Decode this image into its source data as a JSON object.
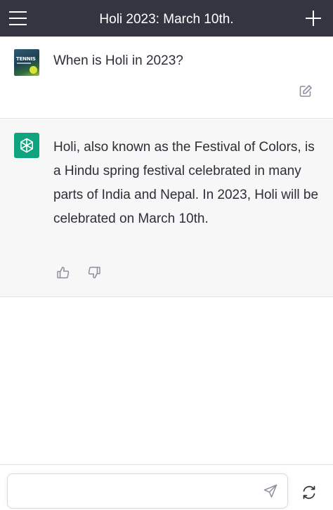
{
  "header": {
    "title": "Holi 2023: March 10th.",
    "menu_icon": "hamburger-menu-icon",
    "new_chat_icon": "plus-icon"
  },
  "conversation": {
    "user_message": {
      "avatar_label": "TENNIS",
      "text": "When is Holi in 2023?",
      "edit_icon": "edit-icon"
    },
    "assistant_message": {
      "avatar_icon": "openai-logo-icon",
      "text": "Holi, also known as the Festival of Colors, is a Hindu spring festival celebrated in many parts of India and Nepal. In 2023, Holi will be celebrated on March 10th.",
      "thumbs_up_icon": "thumbs-up-icon",
      "thumbs_down_icon": "thumbs-down-icon"
    }
  },
  "composer": {
    "value": "",
    "placeholder": "",
    "send_icon": "send-icon",
    "regenerate_icon": "refresh-icon"
  },
  "colors": {
    "header_bg": "#343541",
    "assistant_bg": "#f7f7f8",
    "brand_green": "#10a37f",
    "text": "#2d2f36"
  }
}
